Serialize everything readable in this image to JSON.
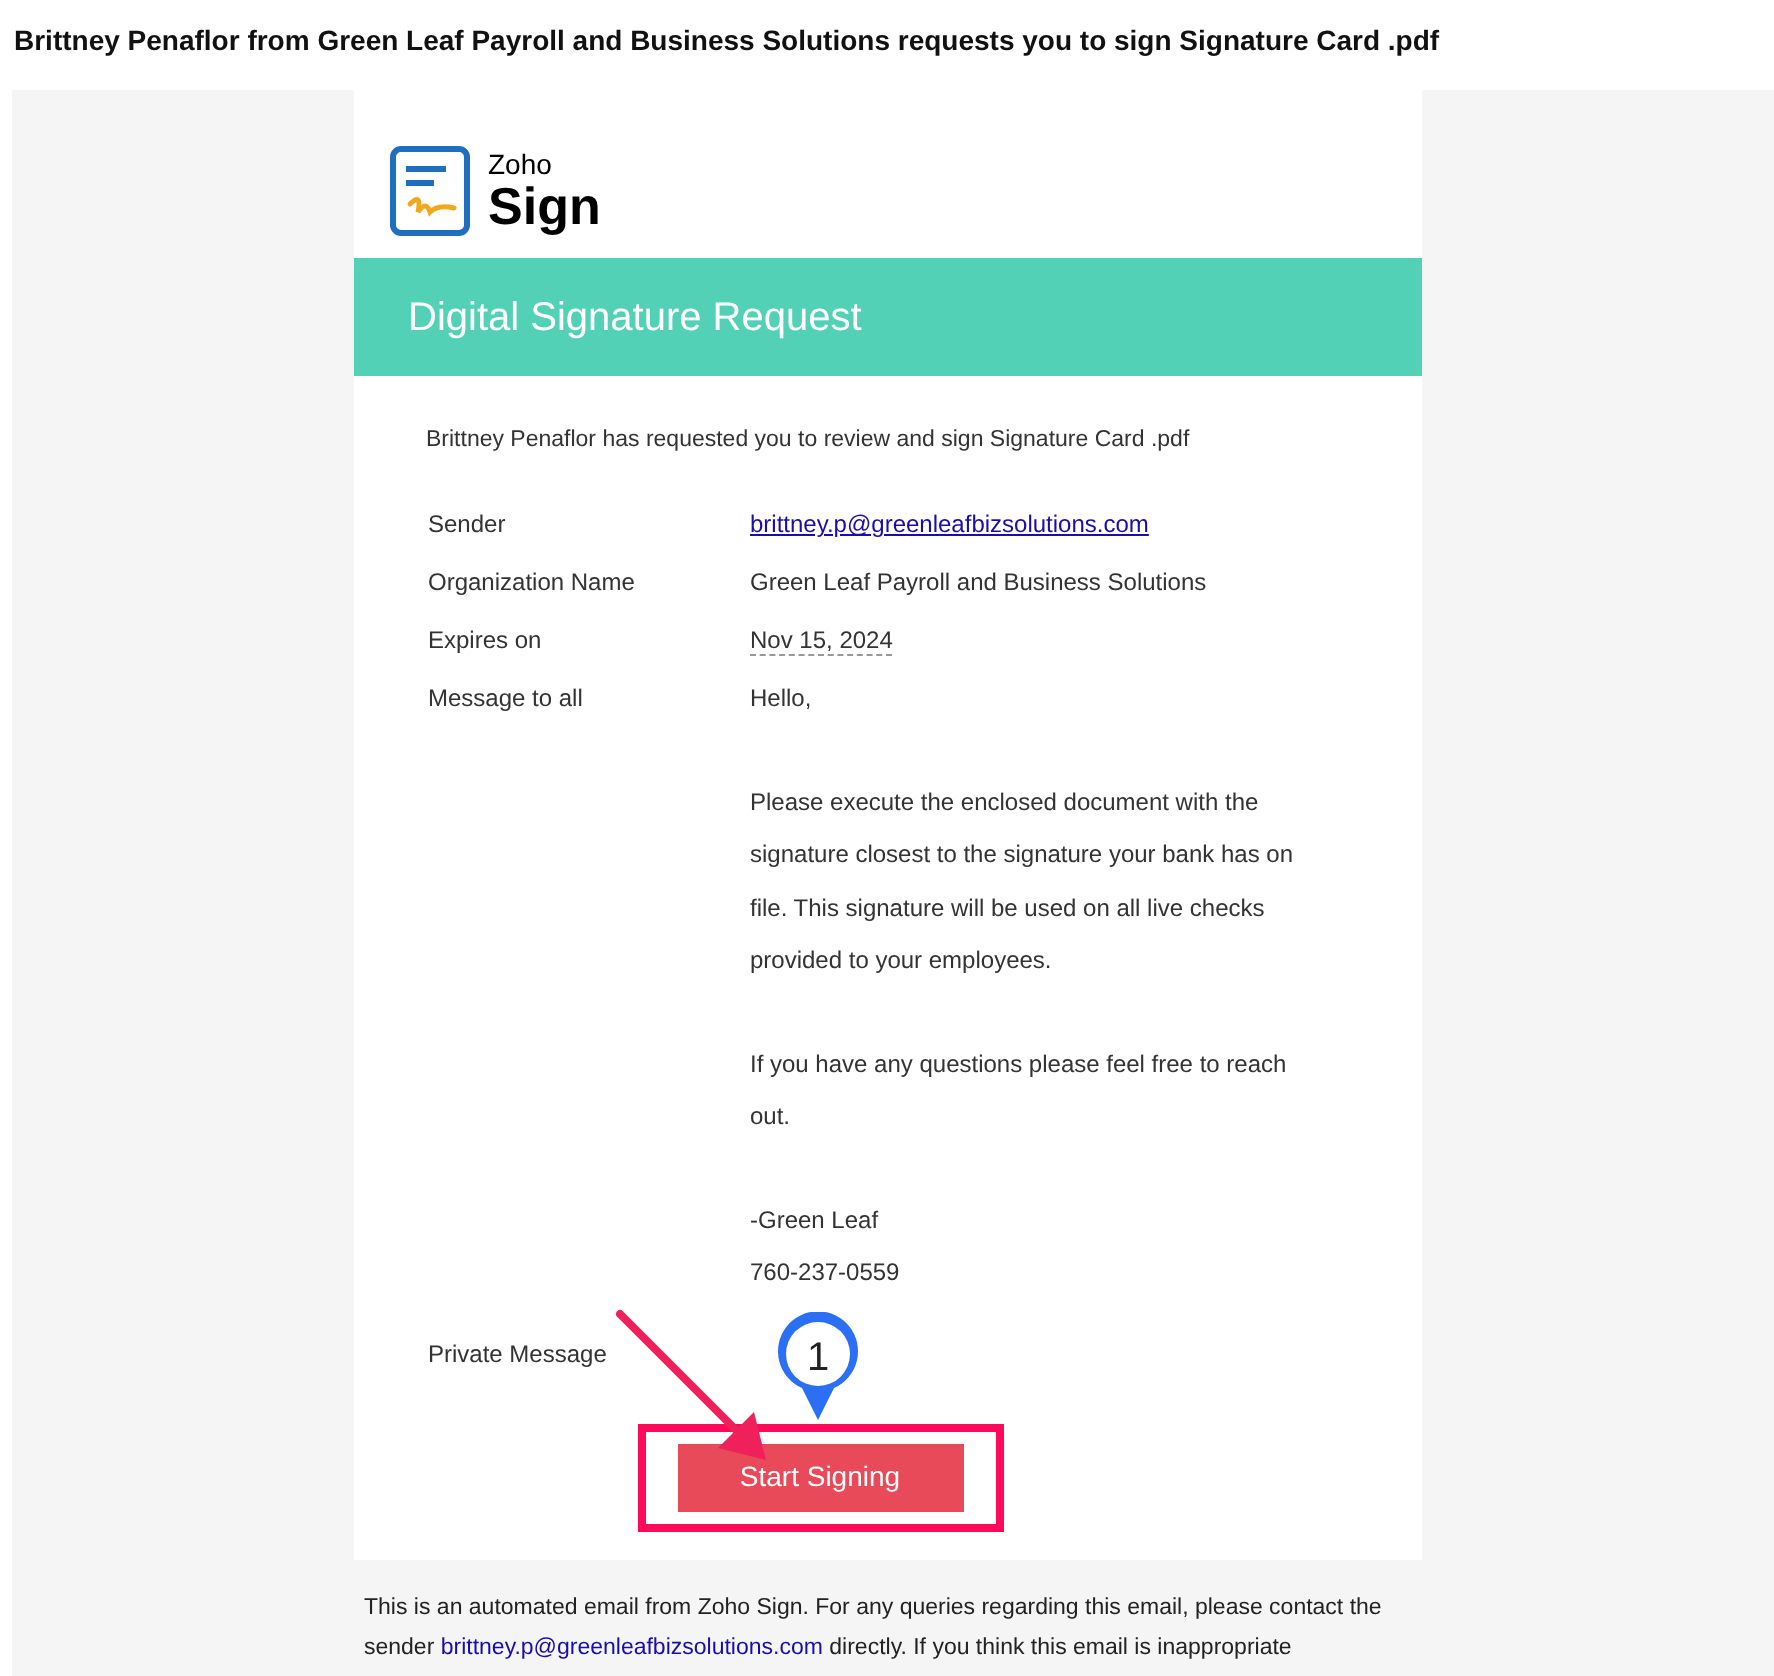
{
  "subject": "Brittney Penaflor from Green Leaf Payroll and Business Solutions requests you to sign Signature Card .pdf",
  "logo": {
    "line_1": "Zoho",
    "line_2": "Sign"
  },
  "banner": {
    "title": "Digital Signature Request"
  },
  "intro": "Brittney Penaflor has requested you to review and sign Signature Card .pdf",
  "details": [
    {
      "kind": "link",
      "label": "Sender",
      "value": "brittney.p@greenleafbizsolutions.com"
    },
    {
      "kind": "text",
      "label": "Organization Name",
      "value": "Green Leaf Payroll and Business Solutions"
    },
    {
      "kind": "date",
      "label": "Expires on",
      "value": "Nov 15, 2024"
    },
    {
      "kind": "message",
      "label": "Message to all",
      "paragraphs": [
        [
          "Hello,"
        ],
        [
          "Please execute the enclosed document with the signature closest to the signature your bank has on file. This signature will be used on all live checks provided to your employees."
        ],
        [
          "If you have any questions please feel free to reach out."
        ],
        [
          "-Green Leaf",
          "760-237-0559"
        ]
      ]
    },
    {
      "kind": "empty",
      "label": "Private Message"
    }
  ],
  "button": {
    "label": "Start Signing"
  },
  "step_marker": {
    "label": "1"
  },
  "footer": {
    "before": "This is an automated email from Zoho Sign. For any queries regarding this email, please contact the sender ",
    "link": "brittney.p@greenleafbizsolutions.com",
    "after": " directly. If you think this email is inappropriate"
  }
}
